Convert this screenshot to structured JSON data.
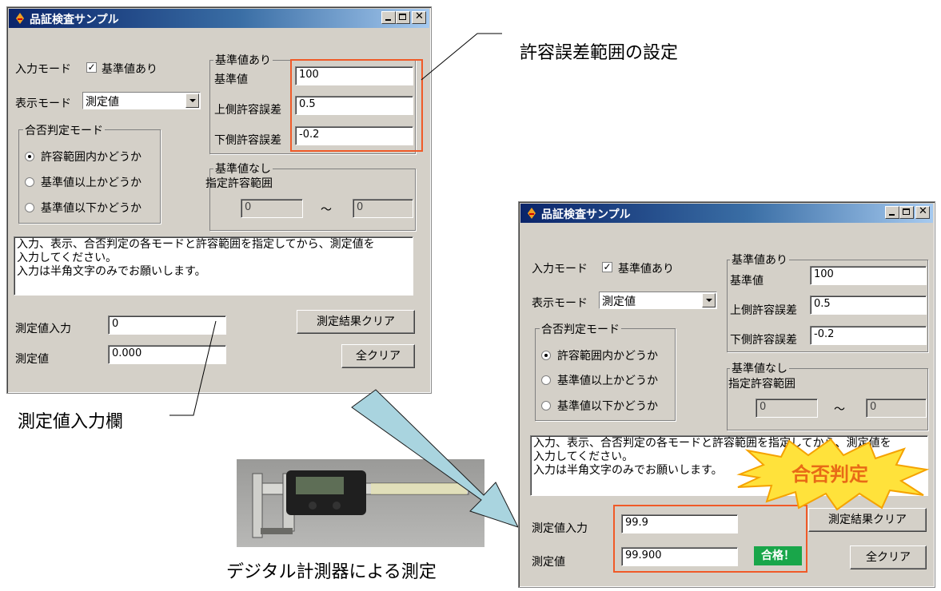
{
  "window": {
    "title": "品証検査サンプル"
  },
  "form": {
    "input_mode_label": "入力モード",
    "ref_checkbox_label": "基準値あり",
    "display_mode_label": "表示モード",
    "display_mode_selected": "測定値",
    "judge_group_title": "合否判定モード",
    "radio_within": "許容範囲内かどうか",
    "radio_above": "基準値以上かどうか",
    "radio_below": "基準値以下かどうか",
    "ref_group_title": "基準値あり",
    "ref_value_label": "基準値",
    "upper_tol_label": "上側許容誤差",
    "lower_tol_label": "下側許容誤差",
    "ref_value": "100",
    "upper_tol": "0.5",
    "lower_tol": "-0.2",
    "noref_group_title": "基準値なし",
    "range_label": "指定許容範囲",
    "range_from": "0",
    "range_tilde": "～",
    "range_to": "0",
    "message": "入力、表示、合否判定の各モードと許容範囲を指定してから、測定値を\n入力してください。\n入力は半角文字のみでお願いします。",
    "measure_input_label": "測定値入力",
    "measure_value_label": "測定値",
    "clear_results_button": "測定結果クリア",
    "clear_all_button": "全クリア"
  },
  "window1": {
    "measure_input": "0",
    "measure_value": "0.000"
  },
  "window2": {
    "measure_input": "99.9",
    "measure_value": "99.900",
    "pass_badge": "合格！",
    "starburst_label": "合否判定"
  },
  "callouts": {
    "tolerance": "許容誤差範囲の設定",
    "input_field": "測定値入力欄",
    "digital_caliper": "デジタル計測器による測定"
  },
  "colors": {
    "highlight": "#f05a28",
    "pass_bg": "#19a64a",
    "arrow": "#a9d4df",
    "starburst": "#ffe23b"
  }
}
